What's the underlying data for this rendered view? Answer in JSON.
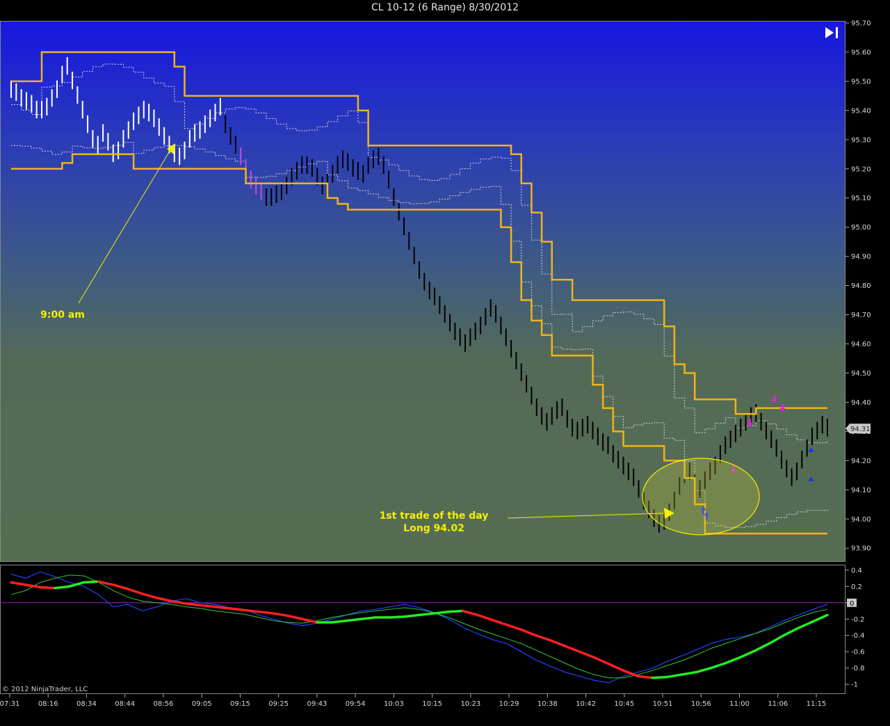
{
  "window": {
    "title": "CL 10-12 (6 Range)  8/30/2012"
  },
  "footer": {
    "copyright": "© 2012 NinjaTrader, LLC"
  },
  "controls": {
    "play_end_icon": "play-to-end-icon"
  },
  "colors": {
    "bars_above_0900": "#ffffff",
    "bars_after": "#000000",
    "bars_transition": "#c050e0",
    "channel": "#f2b418",
    "inner_channel": "#d8d8d8",
    "annotation": "#f5f000",
    "osc_fast": "#2244ff",
    "osc_signal": "#33cc33",
    "osc_slow_down": "#ff2020",
    "osc_slow_up": "#22ee22",
    "zero_line": "#a020c0",
    "price_marker_bg": "#c8c8c8"
  },
  "annotations": {
    "time_label": "9:00 am",
    "trade_line1": "1st trade of the day",
    "trade_line2": "Long 94.02"
  },
  "chart_data": [
    {
      "type": "bar",
      "subtype": "ohlc-range-bars",
      "title": "CL 10-12 (6 Range)  8/30/2012",
      "x_ticks": [
        "07:31",
        "08:16",
        "08:34",
        "08:44",
        "08:56",
        "09:05",
        "09:15",
        "09:25",
        "09:43",
        "09:54",
        "10:03",
        "10:15",
        "10:23",
        "10:29",
        "10:38",
        "10:42",
        "10:45",
        "10:51",
        "10:56",
        "11:00",
        "11:06",
        "11:15"
      ],
      "y_ticks": [
        95.7,
        95.6,
        95.5,
        95.4,
        95.3,
        95.2,
        95.1,
        95.0,
        94.9,
        94.8,
        94.7,
        94.6,
        94.5,
        94.4,
        94.3,
        94.2,
        94.1,
        94.0,
        93.9
      ],
      "ylim": [
        93.86,
        95.7
      ],
      "last_price": "94.31",
      "grid": false,
      "bar_range": 0.06,
      "closes": [
        95.47,
        95.46,
        95.44,
        95.43,
        95.42,
        95.4,
        95.4,
        95.41,
        95.44,
        95.47,
        95.52,
        95.55,
        95.5,
        95.45,
        95.4,
        95.35,
        95.3,
        95.28,
        95.32,
        95.29,
        95.25,
        95.26,
        95.3,
        95.33,
        95.36,
        95.38,
        95.4,
        95.39,
        95.37,
        95.34,
        95.31,
        95.28,
        95.25,
        95.24,
        95.26,
        95.3,
        95.32,
        95.33,
        95.35,
        95.37,
        95.39,
        95.41,
        95.35,
        95.31,
        95.28,
        95.24,
        95.2,
        95.16,
        95.14,
        95.12,
        95.1,
        95.1,
        95.11,
        95.12,
        95.14,
        95.17,
        95.19,
        95.21,
        95.21,
        95.2,
        95.17,
        95.14,
        95.15,
        95.18,
        95.21,
        95.23,
        95.22,
        95.2,
        95.19,
        95.18,
        95.21,
        95.23,
        95.24,
        95.21,
        95.16,
        95.1,
        95.05,
        95.0,
        94.95,
        94.9,
        94.85,
        94.81,
        94.78,
        94.76,
        94.73,
        94.7,
        94.67,
        94.64,
        94.62,
        94.6,
        94.62,
        94.64,
        94.66,
        94.69,
        94.72,
        94.7,
        94.66,
        94.62,
        94.58,
        94.54,
        94.5,
        94.46,
        94.42,
        94.38,
        94.35,
        94.33,
        94.35,
        94.37,
        94.38,
        94.34,
        94.31,
        94.3,
        94.31,
        94.32,
        94.3,
        94.28,
        94.26,
        94.25,
        94.22,
        94.2,
        94.18,
        94.16,
        94.14,
        94.1,
        94.06,
        94.03,
        94.0,
        93.98,
        93.99,
        94.02,
        94.06,
        94.11,
        94.15,
        94.16,
        94.12,
        94.1,
        94.13,
        94.16,
        94.18,
        94.22,
        94.25,
        94.27,
        94.29,
        94.31,
        94.33,
        94.35,
        94.36,
        94.33,
        94.3,
        94.27,
        94.24,
        94.2,
        94.17,
        94.14,
        94.16,
        94.2,
        94.24,
        94.28,
        94.3,
        94.32,
        94.31
      ],
      "series": [
        {
          "name": "upper_band",
          "values": [
            95.5,
            95.5,
            95.5,
            95.6,
            95.6,
            95.6,
            95.6,
            95.6,
            95.6,
            95.6,
            95.6,
            95.6,
            95.6,
            95.6,
            95.6,
            95.6,
            95.55,
            95.45,
            95.45,
            95.45,
            95.45,
            95.45,
            95.45,
            95.45,
            95.45,
            95.45,
            95.45,
            95.45,
            95.45,
            95.45,
            95.45,
            95.45,
            95.45,
            95.45,
            95.4,
            95.28,
            95.28,
            95.28,
            95.28,
            95.28,
            95.28,
            95.28,
            95.28,
            95.28,
            95.28,
            95.28,
            95.28,
            95.28,
            95.28,
            95.25,
            95.15,
            95.05,
            94.95,
            94.82,
            94.82,
            94.75,
            94.75,
            94.75,
            94.75,
            94.75,
            94.75,
            94.75,
            94.75,
            94.75,
            94.66,
            94.53,
            94.5,
            94.41,
            94.41,
            94.41,
            94.41,
            94.36,
            94.36,
            94.38,
            94.38,
            94.38,
            94.38,
            94.38,
            94.38,
            94.38,
            94.38
          ]
        },
        {
          "name": "lower_band",
          "values": [
            95.2,
            95.2,
            95.2,
            95.2,
            95.2,
            95.22,
            95.25,
            95.25,
            95.25,
            95.25,
            95.25,
            95.25,
            95.2,
            95.2,
            95.2,
            95.2,
            95.2,
            95.2,
            95.2,
            95.2,
            95.2,
            95.2,
            95.2,
            95.15,
            95.15,
            95.15,
            95.15,
            95.15,
            95.15,
            95.15,
            95.15,
            95.1,
            95.08,
            95.06,
            95.06,
            95.06,
            95.06,
            95.06,
            95.06,
            95.06,
            95.06,
            95.06,
            95.06,
            95.06,
            95.06,
            95.06,
            95.06,
            95.06,
            95.0,
            94.88,
            94.75,
            94.68,
            94.63,
            94.56,
            94.56,
            94.56,
            94.56,
            94.46,
            94.38,
            94.3,
            94.25,
            94.25,
            94.25,
            94.25,
            94.2,
            94.2,
            94.14,
            94.05,
            93.95,
            93.95,
            93.95,
            93.95,
            93.95,
            93.95,
            93.95,
            93.95,
            93.95,
            93.95,
            93.95,
            93.95,
            93.95
          ]
        }
      ]
    },
    {
      "type": "line",
      "title": "",
      "y_ticks": [
        0.4,
        0.2,
        0,
        -0.2,
        -0.4,
        -0.6,
        -0.8,
        -1
      ],
      "ylim": [
        -1.05,
        0.45
      ],
      "zero_label": "0",
      "grid": false,
      "series": [
        {
          "name": "",
          "values": [
            0.35,
            0.3,
            0.38,
            0.32,
            0.25,
            0.2,
            0.1,
            -0.05,
            -0.02,
            -0.1,
            -0.05,
            0.02,
            0.05,
            0.0,
            -0.02,
            -0.06,
            -0.08,
            -0.15,
            -0.2,
            -0.25,
            -0.28,
            -0.25,
            -0.2,
            -0.15,
            -0.1,
            -0.08,
            -0.05,
            -0.02,
            -0.06,
            -0.12,
            -0.2,
            -0.3,
            -0.38,
            -0.45,
            -0.5,
            -0.6,
            -0.7,
            -0.78,
            -0.85,
            -0.9,
            -0.95,
            -0.98,
            -0.9,
            -0.85,
            -0.8,
            -0.72,
            -0.65,
            -0.58,
            -0.5,
            -0.45,
            -0.42,
            -0.38,
            -0.3,
            -0.22,
            -0.15,
            -0.08,
            -0.02
          ]
        },
        {
          "name": "",
          "values": [
            0.1,
            0.15,
            0.25,
            0.3,
            0.34,
            0.33,
            0.25,
            0.15,
            0.07,
            0.02,
            0.0,
            -0.02,
            -0.05,
            -0.07,
            -0.1,
            -0.12,
            -0.14,
            -0.18,
            -0.22,
            -0.24,
            -0.25,
            -0.22,
            -0.18,
            -0.15,
            -0.12,
            -0.1,
            -0.08,
            -0.06,
            -0.08,
            -0.12,
            -0.18,
            -0.25,
            -0.32,
            -0.38,
            -0.44,
            -0.5,
            -0.58,
            -0.66,
            -0.74,
            -0.82,
            -0.88,
            -0.92,
            -0.92,
            -0.88,
            -0.83,
            -0.77,
            -0.71,
            -0.64,
            -0.56,
            -0.5,
            -0.44,
            -0.38,
            -0.32,
            -0.25,
            -0.18,
            -0.12,
            -0.08
          ]
        },
        {
          "name": "",
          "values": [
            0.25,
            0.22,
            0.19,
            0.18,
            0.2,
            0.25,
            0.26,
            0.22,
            0.17,
            0.11,
            0.06,
            0.02,
            -0.01,
            -0.03,
            -0.05,
            -0.07,
            -0.09,
            -0.11,
            -0.13,
            -0.16,
            -0.2,
            -0.24,
            -0.24,
            -0.22,
            -0.2,
            -0.18,
            -0.18,
            -0.17,
            -0.15,
            -0.13,
            -0.11,
            -0.1,
            -0.15,
            -0.21,
            -0.27,
            -0.33,
            -0.4,
            -0.46,
            -0.53,
            -0.6,
            -0.67,
            -0.75,
            -0.83,
            -0.9,
            -0.92,
            -0.91,
            -0.88,
            -0.85,
            -0.8,
            -0.74,
            -0.67,
            -0.59,
            -0.5,
            -0.4,
            -0.31,
            -0.23,
            -0.15
          ]
        }
      ]
    }
  ],
  "x_labels_positions_note": ""
}
